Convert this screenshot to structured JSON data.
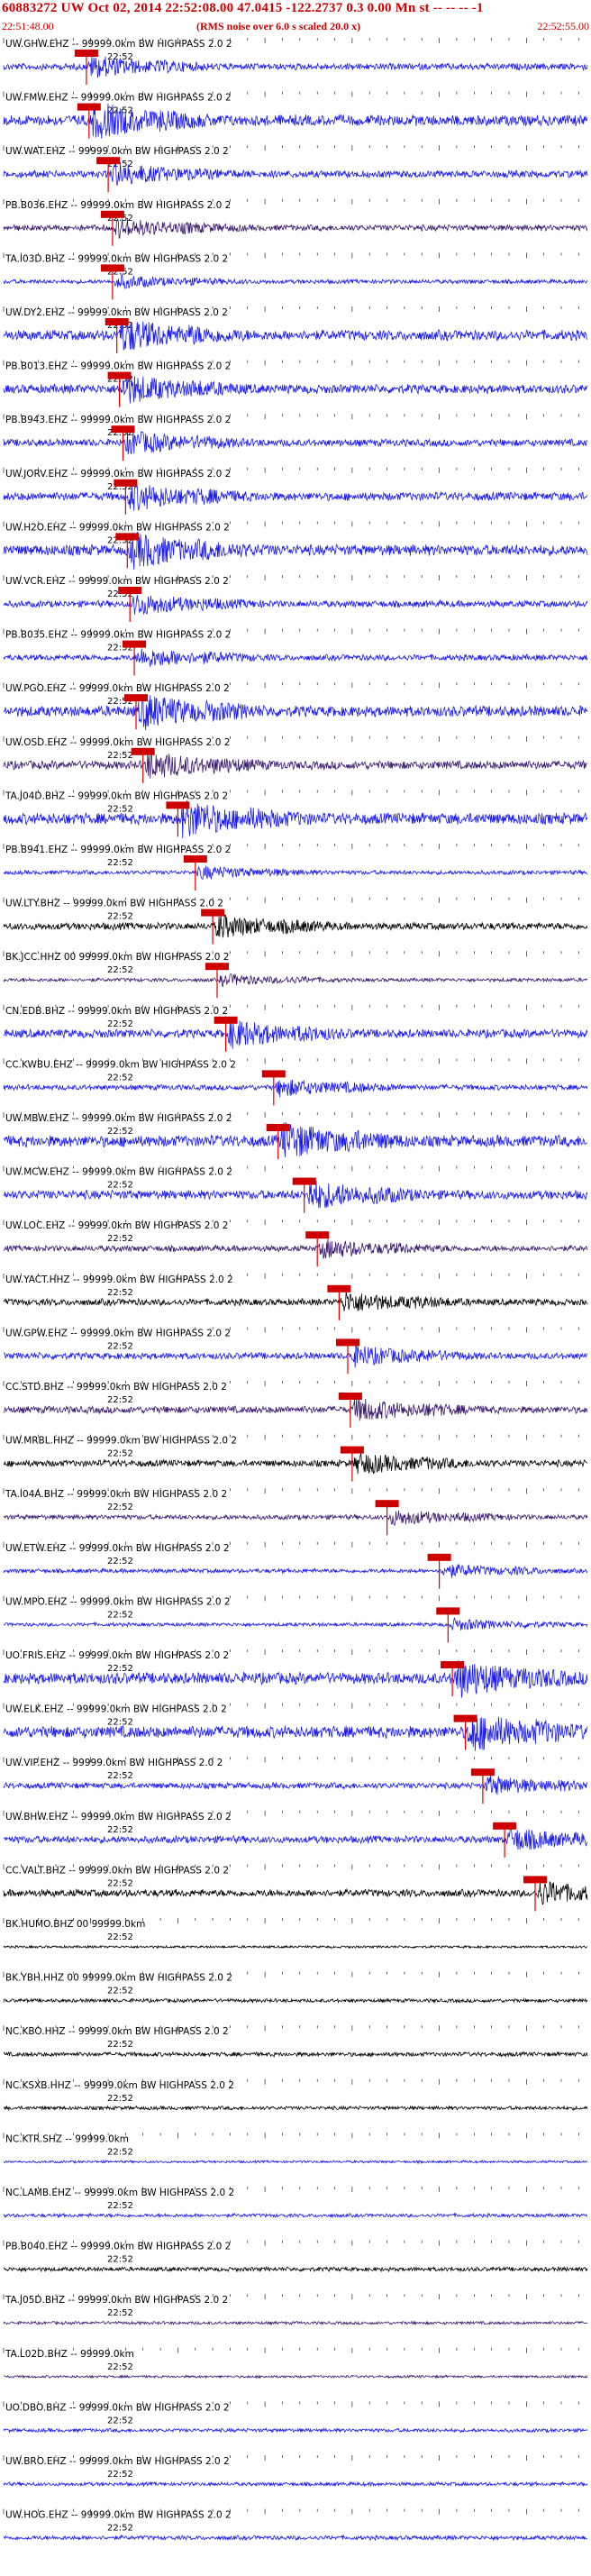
{
  "header": {
    "title": "60883272 UW Oct 02, 2014 22:52:08.00    47.0415  -122.2737   0.3  0.00  Mn st  -- -- --  -1",
    "start_time": "22:51:48.00",
    "end_time": "22:52:55.00",
    "note": "(RMS noise over 6.0 s scaled 20.0 x)"
  },
  "colors": {
    "blue_trace": "#1a1aee",
    "purple_trace": "#3a1a6e",
    "black_trace": "#000000",
    "pick_box": "#cc0000",
    "pick_line": "#dd0000",
    "header_text": "#cc0000"
  },
  "chart_data": {
    "type": "line",
    "title": "60883272 UW Oct 02, 2014 22:52:08.00    47.0415  -122.2737   0.3  0.00  Mn st  -- -- --  -1",
    "x_start": "22:51:48.00",
    "x_end": "22:52:55.00",
    "tick_label": "22:52",
    "series": [
      {
        "name": "UW.GHW.EHZ -- 99999.0km BW  HIGHPASS  2.0  2",
        "color": "blue",
        "pick_s": 9.5,
        "amp": 0.55
      },
      {
        "name": "UW.FMW.EHZ -- 99999.0km BW  HIGHPASS  2.0  2",
        "color": "blue",
        "pick_s": 9.8,
        "amp": 0.9
      },
      {
        "name": "UW.WAT.EHZ -- 99999.0km BW  HIGHPASS  2.0  2",
        "color": "blue",
        "pick_s": 12.0,
        "amp": 0.6
      },
      {
        "name": "PB.B036.EHZ -- 99999.0km BW  HIGHPASS  2.0  2",
        "color": "purple",
        "pick_s": 12.5,
        "amp": 0.5
      },
      {
        "name": "TA.I03D.BHZ -- 99999.0km BW  HIGHPASS  2.0  2",
        "color": "blue",
        "pick_s": 12.5,
        "amp": 0.35
      },
      {
        "name": "UW.DY2.EHZ -- 99999.0km BW  HIGHPASS  2.0  2",
        "color": "blue",
        "pick_s": 13.0,
        "amp": 0.85
      },
      {
        "name": "PB.B013.EHZ -- 99999.0km BW  HIGHPASS  2.0  2",
        "color": "blue",
        "pick_s": 13.3,
        "amp": 0.75
      },
      {
        "name": "PB.B943.EHZ -- 99999.0km BW  HIGHPASS  2.0  2",
        "color": "blue",
        "pick_s": 13.7,
        "amp": 0.6
      },
      {
        "name": "UW.JORV.EHZ -- 99999.0km BW  HIGHPASS  2.0  2",
        "color": "blue",
        "pick_s": 14.0,
        "amp": 0.7
      },
      {
        "name": "UW.H2O.EHZ -- 99999.0km BW  HIGHPASS  2.0  2",
        "color": "blue",
        "pick_s": 14.2,
        "amp": 0.9
      },
      {
        "name": "UW.VCR.EHZ -- 99999.0km BW  HIGHPASS  2.0  2",
        "color": "blue",
        "pick_s": 14.5,
        "amp": 0.55
      },
      {
        "name": "PB.B035.EHZ -- 99999.0km BW  HIGHPASS  2.0  2",
        "color": "blue",
        "pick_s": 15.0,
        "amp": 0.5
      },
      {
        "name": "UW.PGO.EHZ -- 99999.0km BW  HIGHPASS  2.0  2",
        "color": "blue",
        "pick_s": 15.2,
        "amp": 0.9
      },
      {
        "name": "UW.OSD.EHZ -- 99999.0km BW  HIGHPASS  2.0  2",
        "color": "purple",
        "pick_s": 16.0,
        "amp": 0.7
      },
      {
        "name": "TA.J04D.BHZ -- 99999.0km BW  HIGHPASS  2.0  2",
        "color": "blue",
        "pick_s": 20.0,
        "amp": 0.95
      },
      {
        "name": "PB.B941.EHZ -- 99999.0km BW  HIGHPASS  2.0  2",
        "color": "blue",
        "pick_s": 22.0,
        "amp": 0.35
      },
      {
        "name": "UW.LTY.BHZ -- 99999.0km BW  HIGHPASS  2.0  2",
        "color": "black",
        "pick_s": 24.0,
        "amp": 0.6
      },
      {
        "name": "BK.JCC.HHZ 00 99999.0km BW  HIGHPASS  2.0  2",
        "color": "purple",
        "pick_s": 24.5,
        "amp": 0.3
      },
      {
        "name": "CN.EDB.BHZ -- 99999.0km BW  HIGHPASS  2.0  2",
        "color": "blue",
        "pick_s": 25.5,
        "amp": 0.7
      },
      {
        "name": "CC.KWBU.EHZ -- 99999.0km BW  HIGHPASS  2.0  2",
        "color": "blue",
        "pick_s": 31.0,
        "amp": 0.45
      },
      {
        "name": "UW.MBW.EHZ -- 99999.0km BW  HIGHPASS  2.0  2",
        "color": "blue",
        "pick_s": 31.5,
        "amp": 0.95
      },
      {
        "name": "UW.MCW.EHZ -- 99999.0km BW  HIGHPASS  2.0  2",
        "color": "blue",
        "pick_s": 34.5,
        "amp": 0.75
      },
      {
        "name": "UW.LOC.EHZ -- 99999.0km BW  HIGHPASS  2.0  2",
        "color": "purple",
        "pick_s": 36.0,
        "amp": 0.5
      },
      {
        "name": "UW.YACT.HHZ -- 99999.0km BW  HIGHPASS  2.0  2",
        "color": "black",
        "pick_s": 38.5,
        "amp": 0.55
      },
      {
        "name": "UW.GPW.EHZ -- 99999.0km BW  HIGHPASS  2.0  2",
        "color": "blue",
        "pick_s": 39.5,
        "amp": 0.55
      },
      {
        "name": "CC.STD.BHZ -- 99999.0km BW  HIGHPASS  2.0  2",
        "color": "purple",
        "pick_s": 39.8,
        "amp": 0.6
      },
      {
        "name": "UW.MRBL.HHZ -- 99999.0km BW  HIGHPASS  2.0  2",
        "color": "black",
        "pick_s": 40.0,
        "amp": 0.55
      },
      {
        "name": "TA.I04A.BHZ -- 99999.0km BW  HIGHPASS  2.0  2",
        "color": "purple",
        "pick_s": 44.0,
        "amp": 0.4
      },
      {
        "name": "UW.ETW.EHZ -- 99999.0km BW  HIGHPASS  2.0  2",
        "color": "blue",
        "pick_s": 50.0,
        "amp": 0.35
      },
      {
        "name": "UW.MPO.EHZ -- 99999.0km BW  HIGHPASS  2.0  2",
        "color": "blue",
        "pick_s": 51.0,
        "amp": 0.3
      },
      {
        "name": "UO.FRIS.EHZ -- 99999.0km BW  HIGHPASS  2.0  2",
        "color": "blue",
        "pick_s": 51.5,
        "amp": 0.95
      },
      {
        "name": "UW.ELK.EHZ -- 99999.0km BW  HIGHPASS  2.0  2",
        "color": "blue",
        "pick_s": 53.0,
        "amp": 1.0
      },
      {
        "name": "UW.VIP.EHZ -- 99999.0km BW  HIGHPASS  2.0  2",
        "color": "blue",
        "pick_s": 55.0,
        "amp": 0.5
      },
      {
        "name": "UW.BHW.EHZ -- 99999.0km BW  HIGHPASS  2.0  2",
        "color": "blue",
        "pick_s": 57.5,
        "amp": 0.6
      },
      {
        "name": "CC.VALT.BHZ -- 99999.0km BW  HIGHPASS  2.0  2",
        "color": "black",
        "pick_s": 61.0,
        "amp": 0.6
      },
      {
        "name": "BK.HUMO.BHZ 00 99999.0km",
        "color": "black",
        "pick_s": null,
        "amp": 0.2
      },
      {
        "name": "BK.YBH.HHZ 00 99999.0km BW  HIGHPASS  2.0  2",
        "color": "black",
        "pick_s": null,
        "amp": 0.3
      },
      {
        "name": "NC.KBO.HHZ -- 99999.0km BW  HIGHPASS  2.0  2",
        "color": "black",
        "pick_s": null,
        "amp": 0.35
      },
      {
        "name": "NC.KSXB.HHZ -- 99999.0km BW  HIGHPASS  2.0  2",
        "color": "black",
        "pick_s": null,
        "amp": 0.3
      },
      {
        "name": "NC.KTR.SHZ -- 99999.0km",
        "color": "blue",
        "pick_s": null,
        "amp": 0.2
      },
      {
        "name": "NC.LAMB.EHZ -- 99999.0km BW  HIGHPASS  2.0  2",
        "color": "blue",
        "pick_s": null,
        "amp": 0.3
      },
      {
        "name": "PB.B040.EHZ -- 99999.0km BW  HIGHPASS  2.0  2",
        "color": "black",
        "pick_s": null,
        "amp": 0.35
      },
      {
        "name": "TA.J05D.BHZ -- 99999.0km BW  HIGHPASS  2.0  2",
        "color": "purple",
        "pick_s": null,
        "amp": 0.25
      },
      {
        "name": "TA.L02D.BHZ -- 99999.0km",
        "color": "purple",
        "pick_s": null,
        "amp": 0.2
      },
      {
        "name": "UO.DBO.BHZ -- 99999.0km BW  HIGHPASS  2.0  2",
        "color": "blue",
        "pick_s": null,
        "amp": 0.3
      },
      {
        "name": "UW.BRO.EHZ -- 99999.0km BW  HIGHPASS  2.0  2",
        "color": "blue",
        "pick_s": null,
        "amp": 0.3
      },
      {
        "name": "UW.HOG.EHZ -- 99999.0km BW  HIGHPASS  2.0  2",
        "color": "blue",
        "pick_s": null,
        "amp": 0.35
      }
    ]
  }
}
